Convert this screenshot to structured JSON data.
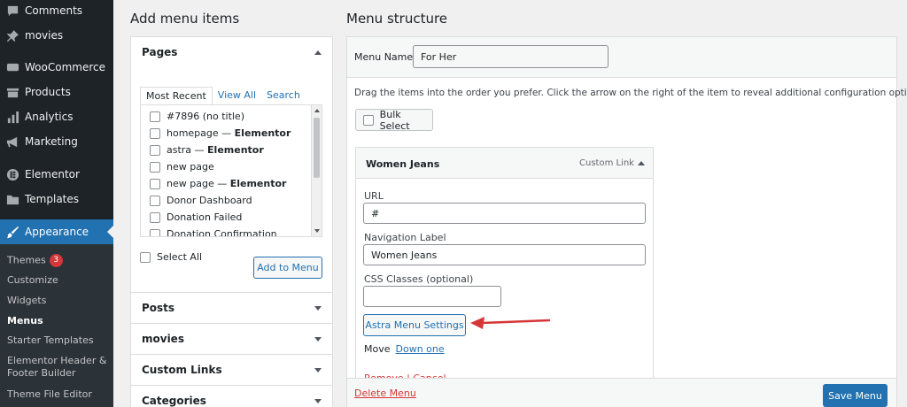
{
  "sidebar": {
    "items": [
      {
        "label": "Comments",
        "icon": "comments-icon"
      },
      {
        "label": "movies",
        "icon": "pin-icon"
      },
      {
        "label": "WooCommerce",
        "icon": "woo-icon"
      },
      {
        "label": "Products",
        "icon": "products-icon"
      },
      {
        "label": "Analytics",
        "icon": "analytics-icon"
      },
      {
        "label": "Marketing",
        "icon": "megaphone-icon"
      },
      {
        "label": "Elementor",
        "icon": "elementor-icon"
      },
      {
        "label": "Templates",
        "icon": "folder-icon"
      },
      {
        "label": "Appearance",
        "icon": "brush-icon"
      }
    ],
    "submenu": [
      {
        "label": "Themes",
        "badge": "3"
      },
      {
        "label": "Customize"
      },
      {
        "label": "Widgets"
      },
      {
        "label": "Menus"
      },
      {
        "label": "Starter Templates"
      },
      {
        "label": "Elementor Header & Footer Builder"
      },
      {
        "label": "Theme File Editor"
      }
    ]
  },
  "add_menu": {
    "heading": "Add menu items",
    "pages": {
      "title": "Pages",
      "tabs": [
        "Most Recent",
        "View All",
        "Search"
      ],
      "items": [
        {
          "text": "#7896 (no title)",
          "suffix": ""
        },
        {
          "text": "homepage — ",
          "suffix": "Elementor"
        },
        {
          "text": "astra — ",
          "suffix": "Elementor"
        },
        {
          "text": "new page",
          "suffix": ""
        },
        {
          "text": "new page — ",
          "suffix": "Elementor"
        },
        {
          "text": "Donor Dashboard",
          "suffix": ""
        },
        {
          "text": "Donation Failed",
          "suffix": ""
        },
        {
          "text": "Donation Confirmation",
          "suffix": ""
        }
      ],
      "select_all": "Select All",
      "add_button": "Add to Menu"
    },
    "sections": [
      "Posts",
      "movies",
      "Custom Links",
      "Categories"
    ]
  },
  "structure": {
    "heading": "Menu structure",
    "menu_name_label": "Menu Name",
    "menu_name_value": "For Her",
    "instructions": "Drag the items into the order you prefer. Click the arrow on the right of the item to reveal additional configuration options.",
    "bulk_select": "Bulk Select",
    "item": {
      "title": "Women Jeans",
      "type": "Custom Link",
      "url_label": "URL",
      "url_value": "#",
      "nav_label": "Navigation Label",
      "nav_value": "Women Jeans",
      "css_label": "CSS Classes (optional)",
      "css_value": "",
      "astra_button": "Astra Menu Settings",
      "move_label": "Move",
      "move_link": "Down one",
      "remove_link": "Remove | Cancel"
    },
    "delete_menu": "Delete Menu",
    "save_menu": "Save Menu"
  },
  "colors": {
    "sidebar_bg": "#1d2327",
    "accent": "#2271b1",
    "danger": "#d63638",
    "annotation_arrow": "#d63638"
  }
}
